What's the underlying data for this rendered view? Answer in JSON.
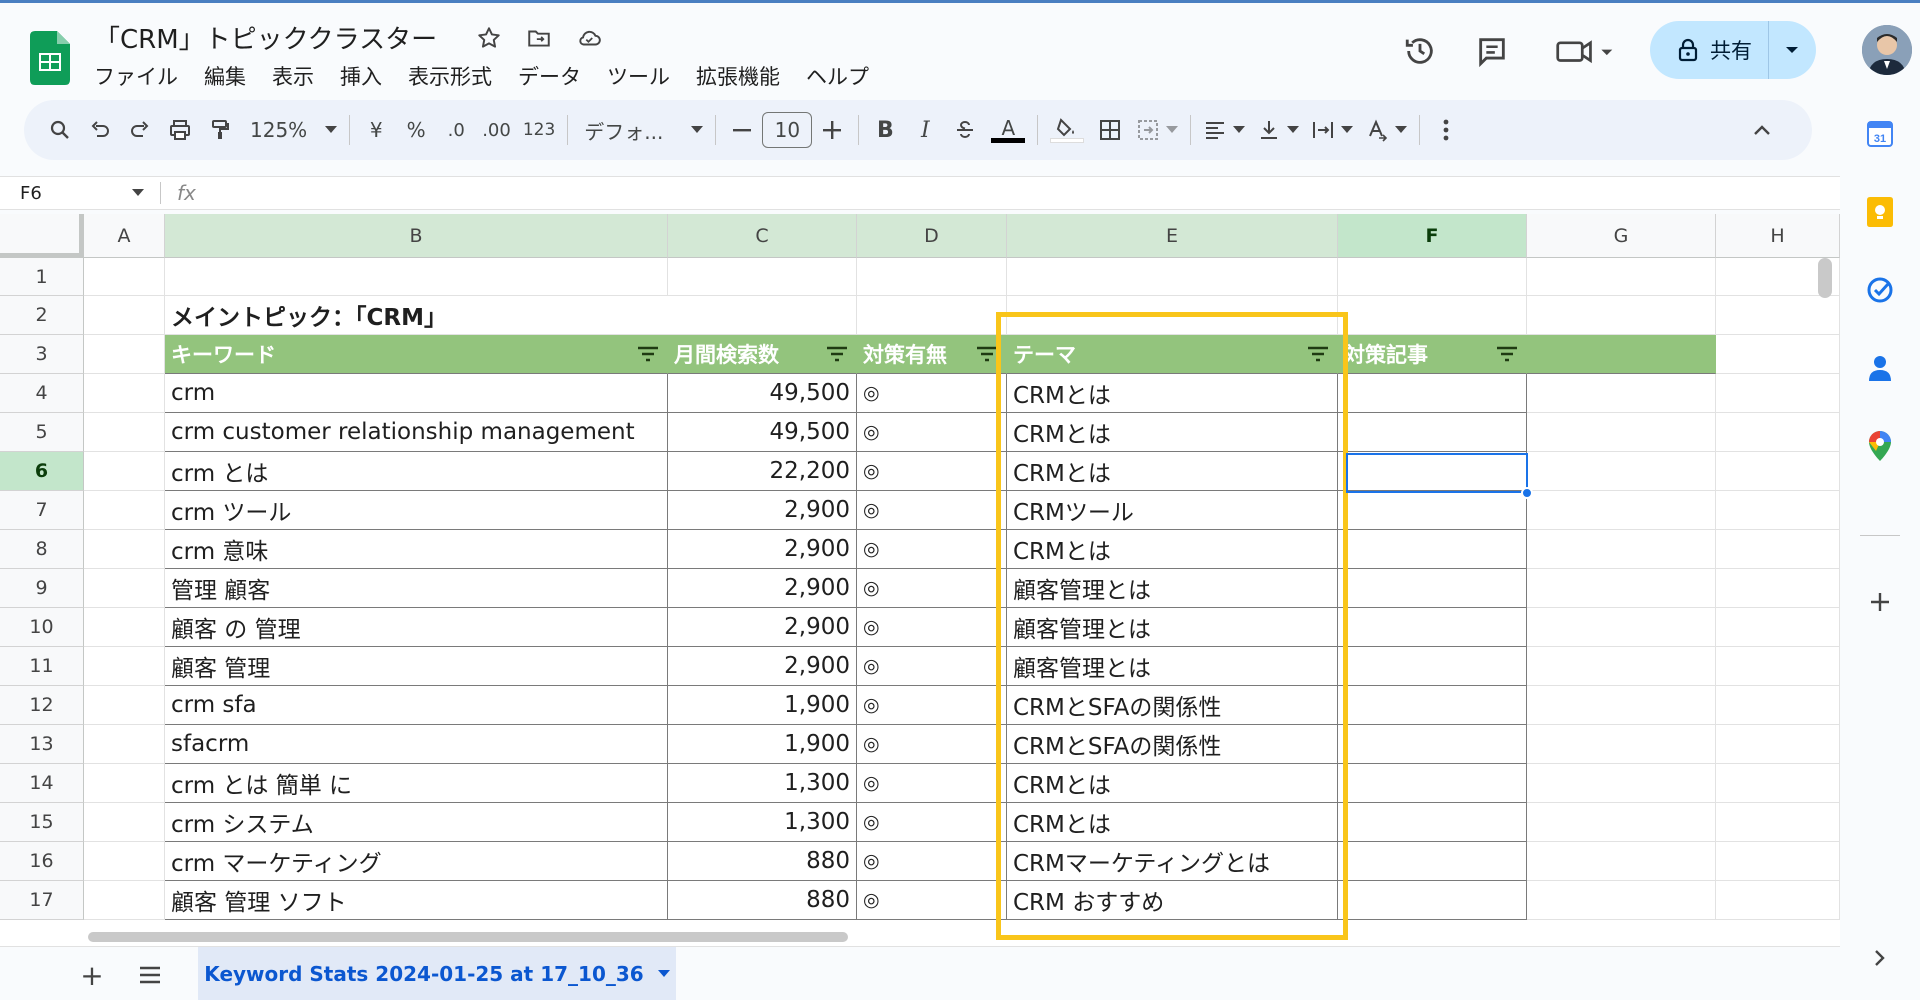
{
  "doc": {
    "title": "「CRM」トピッククラスター",
    "menu": [
      "ファイル",
      "編集",
      "表示",
      "挿入",
      "表示形式",
      "データ",
      "ツール",
      "拡張機能",
      "ヘルプ"
    ]
  },
  "header_right": {
    "share_label": "共有"
  },
  "toolbar": {
    "zoom": "125%",
    "currency": "¥",
    "percent": "%",
    "dec_decrease": ".0",
    "dec_increase": ".00",
    "number_format": "123",
    "font": "デフォ...",
    "font_size": "10",
    "bold": "B",
    "italic": "I",
    "text_color": "A"
  },
  "formula_bar": {
    "name_box": "F6",
    "fx": "fx",
    "value": ""
  },
  "columns": [
    "A",
    "B",
    "C",
    "D",
    "E",
    "F",
    "G",
    "H"
  ],
  "rows": [
    "1",
    "2",
    "3",
    "4",
    "5",
    "6",
    "7",
    "8",
    "9",
    "10",
    "11",
    "12",
    "13",
    "14",
    "15",
    "16",
    "17"
  ],
  "sheet": {
    "title_cell": "メイントピック：「CRM」",
    "headers": [
      "キーワード",
      "月間検索数",
      "対策有無",
      "テーマ",
      "対策記事"
    ],
    "data": [
      {
        "keyword": "crm",
        "volume": "49,500",
        "flag": "◎",
        "theme": "CRMとは"
      },
      {
        "keyword": "crm customer relationship management",
        "volume": "49,500",
        "flag": "◎",
        "theme": "CRMとは"
      },
      {
        "keyword": "crm とは",
        "volume": "22,200",
        "flag": "◎",
        "theme": "CRMとは"
      },
      {
        "keyword": "crm ツール",
        "volume": "2,900",
        "flag": "◎",
        "theme": "CRMツール"
      },
      {
        "keyword": "crm 意味",
        "volume": "2,900",
        "flag": "◎",
        "theme": "CRMとは"
      },
      {
        "keyword": "管理 顧客",
        "volume": "2,900",
        "flag": "◎",
        "theme": "顧客管理とは"
      },
      {
        "keyword": "顧客 の 管理",
        "volume": "2,900",
        "flag": "◎",
        "theme": "顧客管理とは"
      },
      {
        "keyword": "顧客 管理",
        "volume": "2,900",
        "flag": "◎",
        "theme": "顧客管理とは"
      },
      {
        "keyword": "crm sfa",
        "volume": "1,900",
        "flag": "◎",
        "theme": "CRMとSFAの関係性"
      },
      {
        "keyword": "sfacrm",
        "volume": "1,900",
        "flag": "◎",
        "theme": "CRMとSFAの関係性"
      },
      {
        "keyword": "crm とは 簡単 に",
        "volume": "1,300",
        "flag": "◎",
        "theme": "CRMとは"
      },
      {
        "keyword": "crm システム",
        "volume": "1,300",
        "flag": "◎",
        "theme": "CRMとは"
      },
      {
        "keyword": "crm マーケティング",
        "volume": "880",
        "flag": "◎",
        "theme": "CRMマーケティングとは"
      },
      {
        "keyword": "顧客 管理 ソフト",
        "volume": "880",
        "flag": "◎",
        "theme": "CRM おすすめ"
      }
    ]
  },
  "sheet_tabs": [
    {
      "label": "Keyword Stats 2024-01-25 at 17_10_36",
      "active": true
    }
  ],
  "colors": {
    "header_green": "#93c47d",
    "highlight_yellow": "#f9c51a",
    "selection_blue": "#1a73e8",
    "share_bg": "#c2e7ff"
  }
}
